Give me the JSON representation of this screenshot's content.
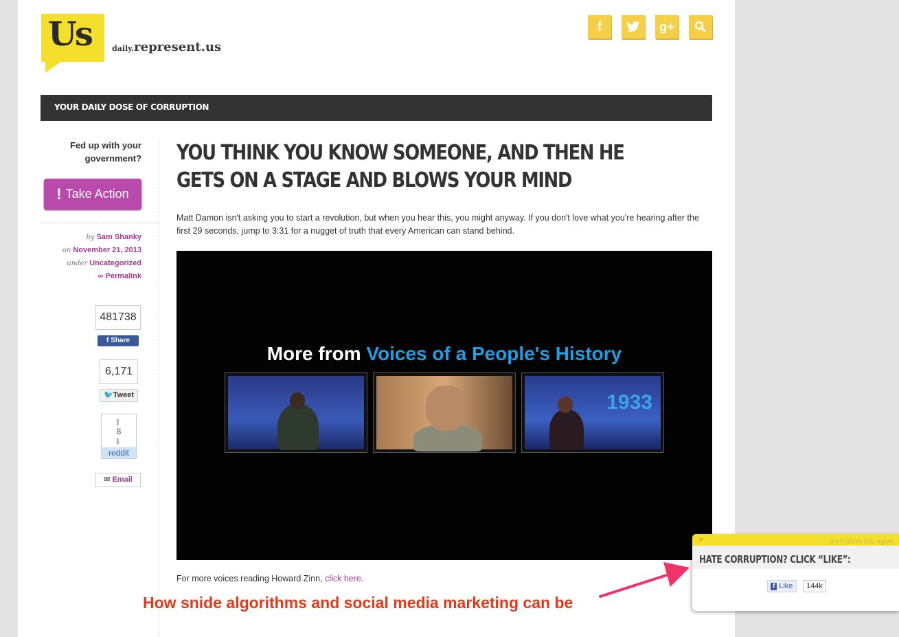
{
  "site": {
    "logo_text": "Us",
    "name_prefix": "daily.",
    "name_main": "represent.us",
    "nav_label": "YOUR DAILY DOSE OF CORRUPTION"
  },
  "social_icons": [
    {
      "icon": "facebook-icon",
      "glyph": "f"
    },
    {
      "icon": "twitter-icon",
      "glyph": "🐦"
    },
    {
      "icon": "google-plus-icon",
      "glyph": "g+"
    },
    {
      "icon": "search-icon",
      "glyph": "🔍"
    }
  ],
  "sidebar": {
    "fedup": "Fed up with your government?",
    "take_action": "Take Action",
    "meta": {
      "by_label": "by",
      "author": "Sam Shanky",
      "on_label": "on",
      "date": "November 21, 2013",
      "under_label": "under",
      "category": "Uncategorized",
      "permalink": "∞ Permalink"
    },
    "facebook_count": "481738",
    "facebook_share": "Share",
    "tweet_count": "6,171",
    "tweet_label": "Tweet",
    "reddit_count": "8",
    "reddit_label": "reddit",
    "email_label": "Email"
  },
  "post": {
    "title": "YOU THINK YOU KNOW SOMEONE, AND THEN HE GETS ON A STAGE AND BLOWS YOUR MIND",
    "intro": "Matt Damon isn't asking you to start a revolution, but when you hear this, you might anyway. If you don't love what you're hearing after the first 29 seconds, jump to 3:31 for a nugget of truth that every American can stand behind.",
    "video_heading_prefix": "More from ",
    "video_heading_highlight": "Voices of a People's History",
    "thumb_year": "1933",
    "more_voices_text": "For more voices reading Howard Zinn, ",
    "more_voices_link": "click here",
    "more_voices_end": "."
  },
  "annotation": {
    "caption": "How snide algorithms and social media marketing can be"
  },
  "popup": {
    "close": "✕",
    "dont_show": "don't show this again",
    "heading": "HATE CORRUPTION? CLICK “LIKE”:",
    "like_label": "Like",
    "like_count": "144k"
  },
  "colors": {
    "brand_yellow": "#f4df2a",
    "accent_purple": "#b84aac",
    "nav_dark": "#333333",
    "video_highlight": "#1da0e3",
    "caption_red": "#e23a1a"
  }
}
